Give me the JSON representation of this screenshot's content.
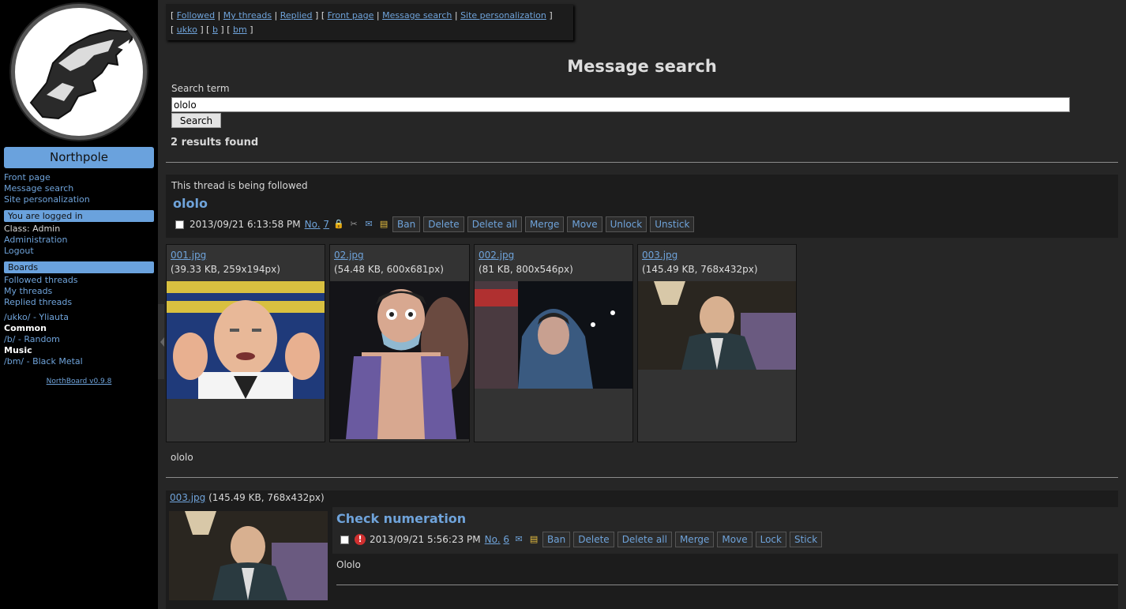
{
  "sidebar": {
    "board_name": "Northpole",
    "nav": [
      {
        "label": "Front page"
      },
      {
        "label": "Message search"
      },
      {
        "label": "Site personalization"
      }
    ],
    "login_header": "You are logged in",
    "class_label": "Class: Admin",
    "admin_link": "Administration",
    "logout_link": "Logout",
    "boards_header": "Boards",
    "board_links": [
      {
        "label": "Followed threads"
      },
      {
        "label": "My threads"
      },
      {
        "label": "Replied threads"
      }
    ],
    "boards": {
      "ukko": "/ukko/ - Yliauta",
      "common_group": "Common",
      "b": "/b/ - Random",
      "music_group": "Music",
      "bm": "/bm/ - Black Metal"
    },
    "version": "NorthBoard v0.9.8"
  },
  "toplinks": {
    "followed": "Followed",
    "my_threads": "My threads",
    "replied": "Replied",
    "front_page": "Front page",
    "message_search": "Message search",
    "site_personalization": "Site personalization",
    "ukko": "ukko",
    "b": "b",
    "bm": "bm"
  },
  "search": {
    "title": "Message search",
    "label": "Search term",
    "value": "ololo",
    "button": "Search",
    "results": "2 results found"
  },
  "thread1": {
    "followed_note": "This thread is being followed",
    "title": "ololo",
    "date": "2013/09/21 6:13:58 PM",
    "no_label": "No.",
    "no_value": "7",
    "buttons": [
      "Ban",
      "Delete",
      "Delete all",
      "Merge",
      "Move",
      "Unlock",
      "Unstick"
    ],
    "files": [
      {
        "name": "001.jpg",
        "meta": "(39.33 KB, 259x194px)"
      },
      {
        "name": "02.jpg",
        "meta": "(54.48 KB, 600x681px)"
      },
      {
        "name": "002.jpg",
        "meta": "(81 KB, 800x546px)"
      },
      {
        "name": "003.jpg",
        "meta": "(145.49 KB, 768x432px)"
      }
    ],
    "body": "ololo"
  },
  "thread2": {
    "file_name": "003.jpg",
    "file_meta": "(145.49 KB, 768x432px)",
    "title": "Check numeration",
    "date": "2013/09/21 5:56:23 PM",
    "no_label": "No.",
    "no_value": "6",
    "buttons": [
      "Ban",
      "Delete",
      "Delete all",
      "Merge",
      "Move",
      "Lock",
      "Stick"
    ],
    "body": "Ololo"
  },
  "icons": {
    "lock": "lock-icon",
    "attach": "paperclip-icon",
    "reply": "reply-icon",
    "folder": "folder-icon",
    "alert": "alert-icon"
  }
}
